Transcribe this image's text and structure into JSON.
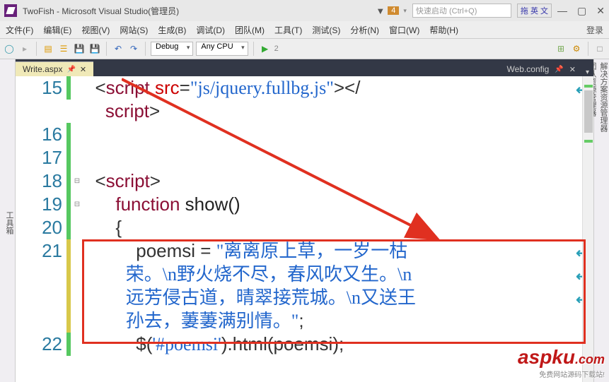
{
  "title": "TwoFish - Microsoft Visual Studio(管理员)",
  "notif_count": "4",
  "quicklaunch_placeholder": "快速启动 (Ctrl+Q)",
  "ime_text": "拖 英 文",
  "menu": {
    "file": "文件(F)",
    "edit": "编辑(E)",
    "view": "视图(V)",
    "website": "网站(S)",
    "build": "生成(B)",
    "debug": "调试(D)",
    "team": "团队(M)",
    "tools": "工具(T)",
    "test": "测试(S)",
    "analyze": "分析(N)",
    "window": "窗口(W)",
    "help": "帮助(H)",
    "login": "登录"
  },
  "toolbar": {
    "config": "Debug",
    "platform": "Any CPU",
    "run": "2"
  },
  "leftrail": "工具箱",
  "rightrail": {
    "a": "解决方案资源管理器",
    "b": "团队资源管理器",
    "c": "属性"
  },
  "tabs": {
    "active": "Write.aspx",
    "right": "Web.config"
  },
  "lines": {
    "15": "15",
    "16": "16",
    "17": "17",
    "18": "18",
    "19": "19",
    "20": "20",
    "21": "21",
    "22": "22"
  },
  "code": {
    "l15a": "<script src=\"js/jquery.fullbg.js\"></",
    "l15b": "script>",
    "l18": "<script>",
    "l19": "function show()",
    "l20": "{",
    "l21": "poemsi = \"离离原上草，一岁一枯荣。\\n野火烧不尽，春风吹又生。\\n远芳侵古道，晴翠接荒城。\\n又送王孙去，萋萋满别情。\";",
    "l22": "$('#poemsi').html(poemsi);"
  },
  "watermark": {
    "brand": "aspku",
    "suffix": ".com",
    "tag": "免费网站源码下载站!"
  }
}
